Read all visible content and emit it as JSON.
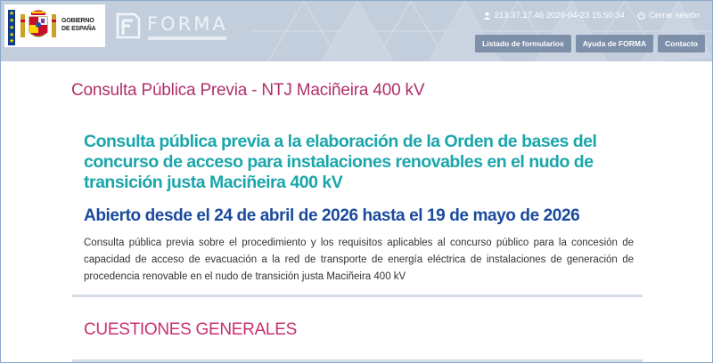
{
  "header": {
    "gov_logo_text": "GOBIERNO\nDE ESPAÑA",
    "forma_logo": "FORMA",
    "session_info": "213.37.17.46 2026-04-23 15:50:34",
    "logout_label": "Cerrar sesión",
    "nav": [
      "Listado de formularios",
      "Ayuda de FORMA",
      "Contacto"
    ]
  },
  "content": {
    "page_title": "Consulta Pública Previa - NTJ Maciñeira 400 kV",
    "headline": "Consulta pública previa a la elaboración de la Orden de bases del concurso de acceso para instalaciones renovables en el nudo de transición justa Maciñeira 400 kV",
    "dates": "Abierto desde el 24 de abril de 2026 hasta el 19 de mayo de 2026",
    "description": "Consulta pública previa sobre el procedimiento y los requisitos aplicables al concurso público para la concesión de capacidad de acceso de evacuación a la red de transporte de energía eléctrica de instalaciones de generación de procedencia renovable en el nudo de transición justa Maciñeira 400 kV",
    "section_title": "CUESTIONES GENERALES"
  },
  "colors": {
    "header_bg": "#c3cedd",
    "nav_button": "#7d8fa9",
    "title": "#b0306a",
    "headline": "#1aa6ab",
    "dates": "#1a4a9e"
  },
  "icons": [
    "user-icon",
    "power-icon",
    "forma-mark-icon",
    "coat-of-arms-icon"
  ]
}
